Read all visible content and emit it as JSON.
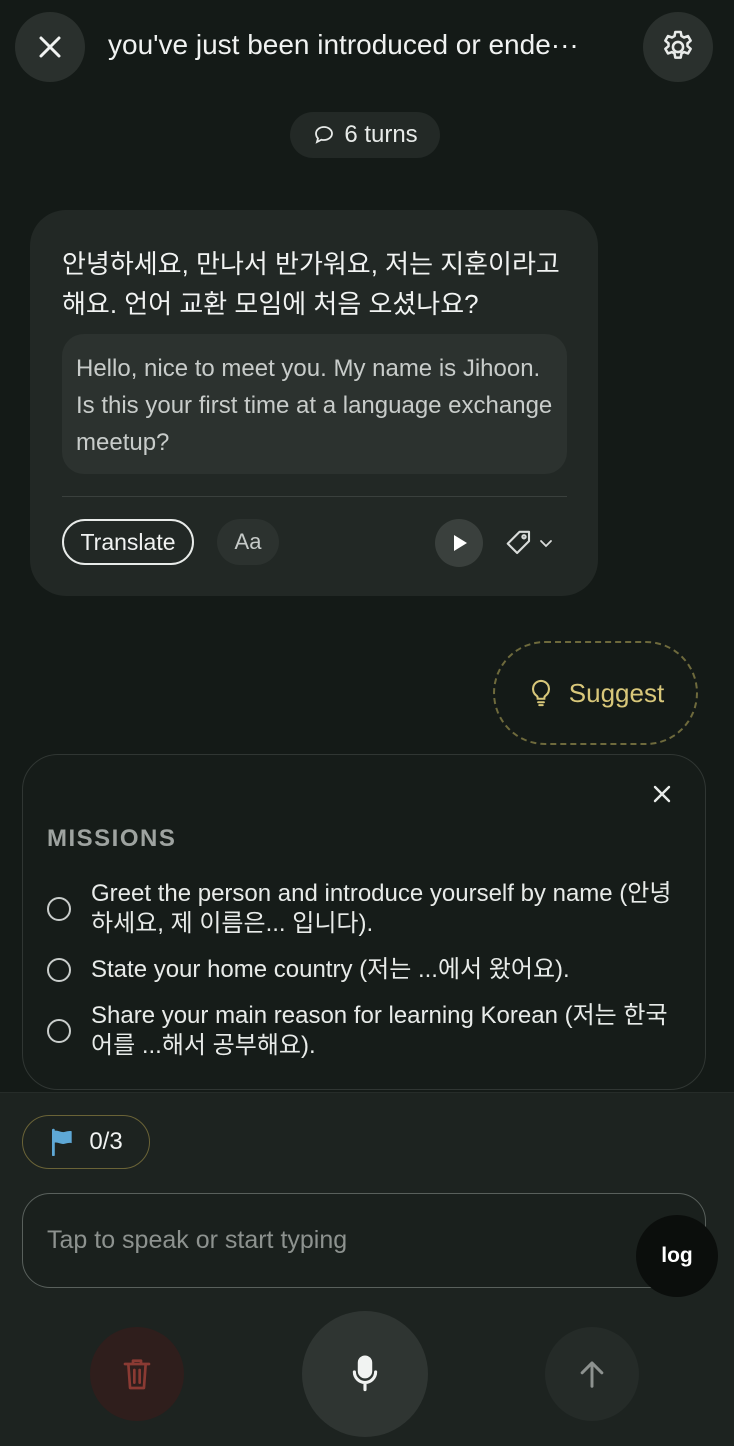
{
  "header": {
    "title": "you've just been introduced or ende···",
    "close_icon": "close-icon",
    "settings_icon": "gear-icon"
  },
  "turns": {
    "label": "6 turns",
    "icon": "chat-bubble-icon"
  },
  "message": {
    "korean": "안녕하세요, 만나서 반가워요, 저는 지훈이라고 해요. 언어 교환 모임에 처음 오셨나요?",
    "english": "Hello, nice to meet you. My name is Jihoon. Is this your first time at a language exchange meetup?",
    "translate_label": "Translate",
    "font_label": "Aa",
    "play_icon": "play-icon",
    "tag_icon": "tag-icon"
  },
  "suggest": {
    "label": "Suggest",
    "icon": "lightbulb-icon"
  },
  "missions": {
    "title": "MISSIONS",
    "items": [
      {
        "text": "Greet the person and introduce yourself by name (안녕하세요, 제 이름은... 입니다).",
        "done": false
      },
      {
        "text": "State your home country (저는 ...에서 왔어요).",
        "done": false
      },
      {
        "text": "Share your main reason for learning Korean (저는 한국어를 ...해서 공부해요).",
        "done": false
      }
    ]
  },
  "progress": {
    "label": "0/3",
    "icon": "flag-icon"
  },
  "input": {
    "placeholder": "Tap to speak or start typing",
    "value": ""
  },
  "log": {
    "label": "log"
  },
  "controls": {
    "delete_icon": "trash-icon",
    "mic_icon": "microphone-icon",
    "send_icon": "arrow-up-icon"
  },
  "colors": {
    "accent_gold": "#d8c77a",
    "flag_blue": "#5ea8d6",
    "delete_red": "#8a3a33",
    "background": "#141a17"
  }
}
